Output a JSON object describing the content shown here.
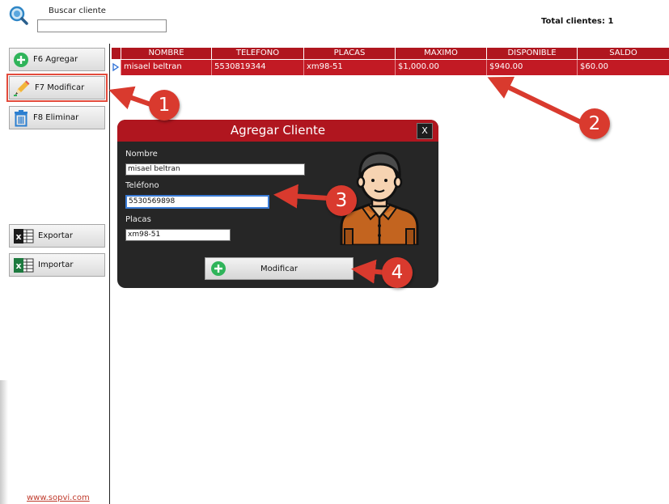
{
  "search": {
    "label": "Buscar cliente",
    "value": "",
    "icon": "magnifier-icon"
  },
  "summary": {
    "total_clients": "Total clientes: 1"
  },
  "sidebar": {
    "buttons": [
      {
        "label": "F6 Agregar",
        "icon": "add-circle-icon"
      },
      {
        "label": "F7 Modificar",
        "icon": "pencil-icon"
      },
      {
        "label": "F8 Eliminar",
        "icon": "trash-icon"
      },
      {
        "label": "Exportar",
        "icon": "excel-icon"
      },
      {
        "label": "Importar",
        "icon": "excel-icon"
      }
    ],
    "website": "www.sopvi.com"
  },
  "grid": {
    "columns": [
      "NOMBRE",
      "TELEFONO",
      "PLACAS",
      "MAXIMO",
      "DISPONIBLE",
      "SALDO"
    ],
    "rows": [
      [
        "misael beltran",
        "5530819344",
        "xm98-51",
        "$1,000.00",
        "$940.00",
        "$60.00"
      ]
    ],
    "row_indicator": "▷"
  },
  "dialog": {
    "title": "Agregar Cliente",
    "close_label": "X",
    "fields": [
      {
        "label": "Nombre",
        "value": "misael beltran"
      },
      {
        "label": "Teléfono",
        "value": "5530569898"
      },
      {
        "label": "Placas",
        "value": "xm98-51"
      }
    ],
    "submit_label": "Modificar",
    "avatar_icon": "user-avatar-icon"
  },
  "annotations": [
    "1",
    "2",
    "3",
    "4"
  ],
  "colors": {
    "accent_red": "#b0161f",
    "row_red": "#c21a24",
    "dialog_bg": "#262626",
    "annotation_red": "#d93a2e",
    "green": "#2fb45a"
  }
}
